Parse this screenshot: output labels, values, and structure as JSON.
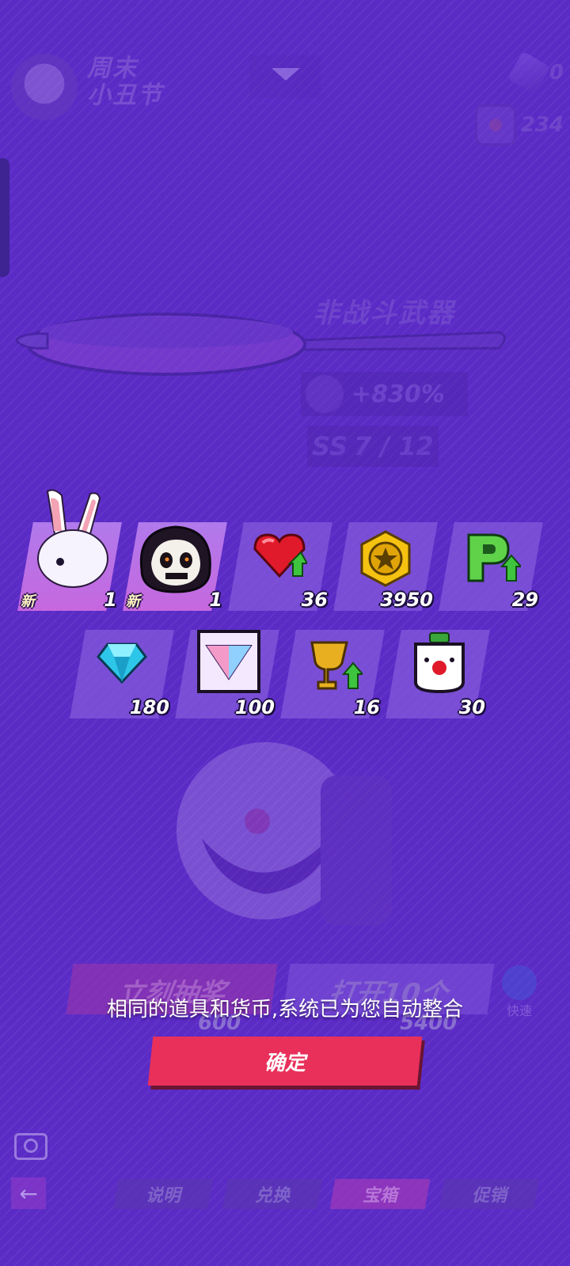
{
  "event": {
    "title_line1": "周末",
    "title_line2": "小丑节"
  },
  "currencies": [
    {
      "icon": "purple-cube-icon",
      "value": "0"
    },
    {
      "icon": "clown-token-icon",
      "value": "234"
    }
  ],
  "weapon": {
    "type_label": "非战斗武器",
    "boost": "+830%",
    "rank_grade": "SS",
    "rank_progress": "7 / 12"
  },
  "rewards": [
    {
      "icon": "bunny-hat-icon",
      "qty": "1",
      "new_label": "新"
    },
    {
      "icon": "skull-hood-icon",
      "qty": "1",
      "new_label": "新"
    },
    {
      "icon": "ruby-heart-upgrade-icon",
      "qty": "36"
    },
    {
      "icon": "gold-coin-icon",
      "qty": "3950"
    },
    {
      "icon": "rank-p-upgrade-icon",
      "qty": "29"
    },
    {
      "icon": "blue-diamond-icon",
      "qty": "180"
    },
    {
      "icon": "prism-gem-card-icon",
      "qty": "100"
    },
    {
      "icon": "trophy-upgrade-icon",
      "qty": "16"
    },
    {
      "icon": "clown-token-icon",
      "qty": "30"
    }
  ],
  "background_buttons": {
    "draw_now": "立刻抽奖",
    "draw_now_price": "600",
    "open_ten": "打开10个",
    "open_ten_price": "5400",
    "quick": "快速"
  },
  "notice": "相同的道具和货币,系统已为您自动整合",
  "confirm_label": "确定",
  "nav": {
    "tabs": [
      "说明",
      "兑换",
      "宝箱",
      "促销"
    ],
    "active_index": 2
  },
  "colors": {
    "confirm": "#e8305a",
    "background": "#5b2bc6"
  }
}
